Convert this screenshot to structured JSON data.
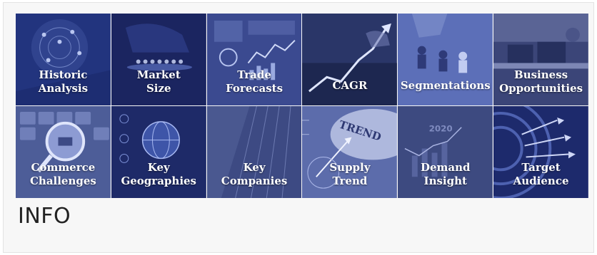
{
  "tiles": [
    {
      "label": "Historic\nAnalysis",
      "icon": "globe-network-icon"
    },
    {
      "label": "Market\nSize",
      "icon": "hand-people-icon"
    },
    {
      "label": "Trade\nForecasts",
      "icon": "dashboard-icon"
    },
    {
      "label": "CAGR",
      "icon": "growth-arrow-icon"
    },
    {
      "label": "Segmentations",
      "icon": "hand-pawns-icon"
    },
    {
      "label": "Business\nOpportunities",
      "icon": "office-meeting-icon"
    },
    {
      "label": "Commerce\nChallenges",
      "icon": "magnifier-cart-icon"
    },
    {
      "label": "Key\nGeographies",
      "icon": "digital-globe-icon"
    },
    {
      "label": "Key\nCompanies",
      "icon": "skyscraper-icon"
    },
    {
      "label": "Supply\nTrend",
      "icon": "compass-trend-icon"
    },
    {
      "label": "Demand\nInsight",
      "icon": "chart-2020-icon"
    },
    {
      "label": "Target\nAudience",
      "icon": "darts-target-icon"
    }
  ],
  "trend_word": "TREND",
  "year_text": "2020",
  "info_title": "INFO"
}
